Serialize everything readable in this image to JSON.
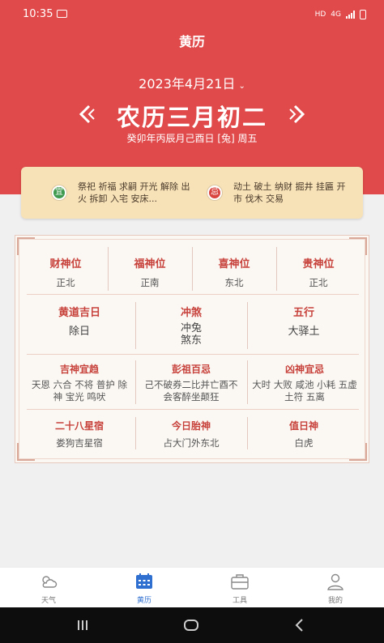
{
  "status_bar": {
    "time": "10:35",
    "network": "HD",
    "cell": "4G"
  },
  "header": {
    "title": "黄历",
    "date": "2023年4月21日",
    "lunar_date": "农历三月初二",
    "ganzhi": "癸卯年丙辰月己酉日 [兔] 周五"
  },
  "yi_ji": {
    "yi_badge": "宜",
    "yi_text": "祭祀 祈福 求嗣 开光 解除 出火 拆卸 入宅 安床...",
    "ji_badge": "忌",
    "ji_text": "动土 破土 纳财 掘井 挂匾 开市 伐木 交易"
  },
  "board": {
    "row1": [
      {
        "label": "财神位",
        "value": "正北"
      },
      {
        "label": "福神位",
        "value": "正南"
      },
      {
        "label": "喜神位",
        "value": "东北"
      },
      {
        "label": "贵神位",
        "value": "正北"
      }
    ],
    "row2": [
      {
        "label": "黄道吉日",
        "value": "除日"
      },
      {
        "label": "冲煞",
        "value": "冲兔\n煞东"
      },
      {
        "label": "五行",
        "value": "大驿土"
      }
    ],
    "row3": [
      {
        "label": "吉神宜趋",
        "value": "天恩 六合 不将 普护 除神 宝光 鸣吠"
      },
      {
        "label": "彭祖百忌",
        "value": "己不破券二比并亡酉不会客醉坐颠狂"
      },
      {
        "label": "凶神宜忌",
        "value": "大时 大败 咸池 小耗 五虚 土符 五离"
      }
    ],
    "row4": [
      {
        "label": "二十八星宿",
        "value": "娄狗吉星宿"
      },
      {
        "label": "今日胎神",
        "value": "占大门外东北"
      },
      {
        "label": "值日神",
        "value": "白虎"
      }
    ]
  },
  "tabs": [
    {
      "label": "天气",
      "icon": "weather-icon"
    },
    {
      "label": "黄历",
      "icon": "calendar-icon"
    },
    {
      "label": "工具",
      "icon": "toolbox-icon"
    },
    {
      "label": "我的",
      "icon": "profile-icon"
    }
  ],
  "colors": {
    "primary_red": "#e04a4b",
    "accent_blue": "#2f6fd0",
    "yi_green": "#3d9a4e",
    "card_bg": "#f7e1b7"
  }
}
